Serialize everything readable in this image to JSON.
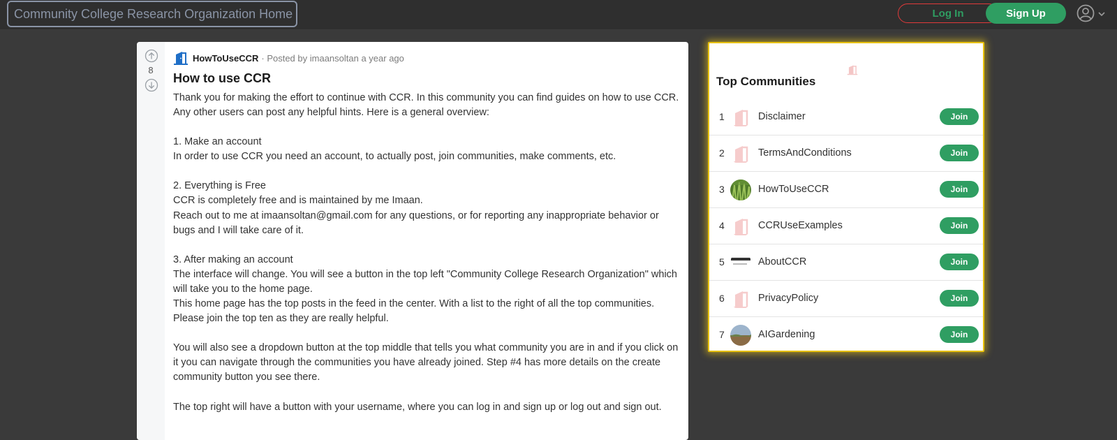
{
  "header": {
    "home_label": "Community College Research Organization Home",
    "login_label": "Log In",
    "signup_label": "Sign Up",
    "user_icon": "user-circle-icon",
    "chevron_icon": "chevron-down-icon"
  },
  "post": {
    "vote_count": "8",
    "community": "HowToUseCCR",
    "meta": "· Posted by imaansoltan a year ago",
    "title": "How to use CCR",
    "body": [
      "Thank you for making the effort to continue with CCR. In this community you can find guides on how to use CCR. Any other users can post any helpful hints. Here is a general overview:",
      "",
      "1. Make an account",
      "In order to use CCR you need an account, to actually post, join communities, make comments, etc.",
      "",
      "2. Everything is Free",
      "CCR is completely free and is maintained by me Imaan.",
      "Reach out to me at imaansoltan@gmail.com for any questions, or for reporting any inappropriate behavior or bugs and I will take care of it.",
      "",
      "3. After making an account",
      "The interface will change. You will see a button in the top left \"Community College Research Organization\" which will take you to the home page.",
      "This home page has the top posts in the feed in the center. With a list to the right of all the top communities. Please join the top ten as they are really helpful.",
      "",
      "You will also see a dropdown button at the top middle that tells you what community you are in and if you click on it you can navigate through the communities you have already joined. Step #4 has more details on the create community button you see there.",
      "",
      "The top right will have a button with your username, where you can log in and sign up or log out and sign out."
    ]
  },
  "sidebar": {
    "title": "Top Communities",
    "join_label": "Join",
    "communities": [
      {
        "rank": "1",
        "name": "Disclaimer",
        "avatar": "door-icon"
      },
      {
        "rank": "2",
        "name": "TermsAndConditions",
        "avatar": "door-icon"
      },
      {
        "rank": "3",
        "name": "HowToUseCCR",
        "avatar": "grass-photo"
      },
      {
        "rank": "4",
        "name": "CCRUseExamples",
        "avatar": "door-icon"
      },
      {
        "rank": "5",
        "name": "AboutCCR",
        "avatar": "aboutccr-text-logo"
      },
      {
        "rank": "6",
        "name": "PrivacyPolicy",
        "avatar": "door-icon"
      },
      {
        "rank": "7",
        "name": "AIGardening",
        "avatar": "landscape-photo"
      }
    ]
  },
  "colors": {
    "accent_green": "#2f9e62",
    "login_border": "#e03a3a",
    "highlight_yellow": "#e8c20a",
    "background": "#3a3a3a"
  }
}
